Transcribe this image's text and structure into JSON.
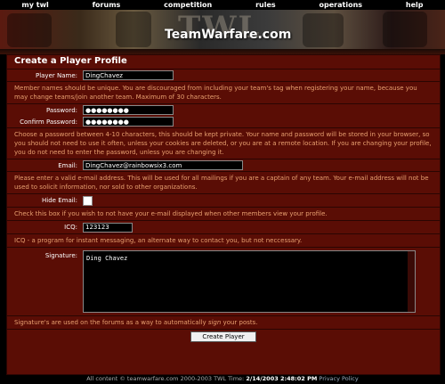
{
  "nav": [
    "my twl",
    "forums",
    "competition",
    "rules",
    "operations",
    "help"
  ],
  "banner": {
    "watermark": "TWL",
    "logo": "TeamWarfare.com"
  },
  "form": {
    "title": "Create a Player Profile",
    "player_label": "Player Name:",
    "player_value": "DingChavez",
    "player_help": "Member names should be unique. You are discouraged from including your team's tag when registering your name, because you may change teams/join another team. Maximum of 30 characters.",
    "password_label": "Password:",
    "password_value": "●●●●●●●●",
    "confirm_label": "Confirm Password:",
    "confirm_value": "●●●●●●●●",
    "password_help": "Choose a password between 4-10 characters, this should be kept private. Your name and password will be stored in your browser, so you should not need to use it often, unless your cookies are deleted, or you are at a remote location. If you are changing your profile, you do not need to enter the password, unless you are changing it.",
    "email_label": "Email:",
    "email_value": "DingChavez@rainbowsix3.com",
    "email_help": "Please enter a valid e-mail address. This will be used for all mailings if you are a captain of any team. Your e-mail address will not be used to solicit information, nor sold to other organizations.",
    "hide_label": "Hide Email:",
    "hide_help": "Check this box if you wish to not have your e-mail displayed when other members view your profile.",
    "icq_label": "ICQ:",
    "icq_value": "123123",
    "icq_help": "ICQ - a program for instant messaging, an alternate way to contact you, but not neccessary.",
    "signature_label": "Signature:",
    "signature_value": "Ding Chavez",
    "signature_help_pre": "Signature's are used on the forums as a way to automatically ",
    "signature_help_em": "sign",
    "signature_help_post": " your posts.",
    "submit": "Create Player"
  },
  "footer": {
    "pre": "All content © teamwarfare.com 2000-2003 TWL Time:",
    "time": "2/14/2003 2:48:02 PM",
    "privacy": "Privacy Policy"
  }
}
